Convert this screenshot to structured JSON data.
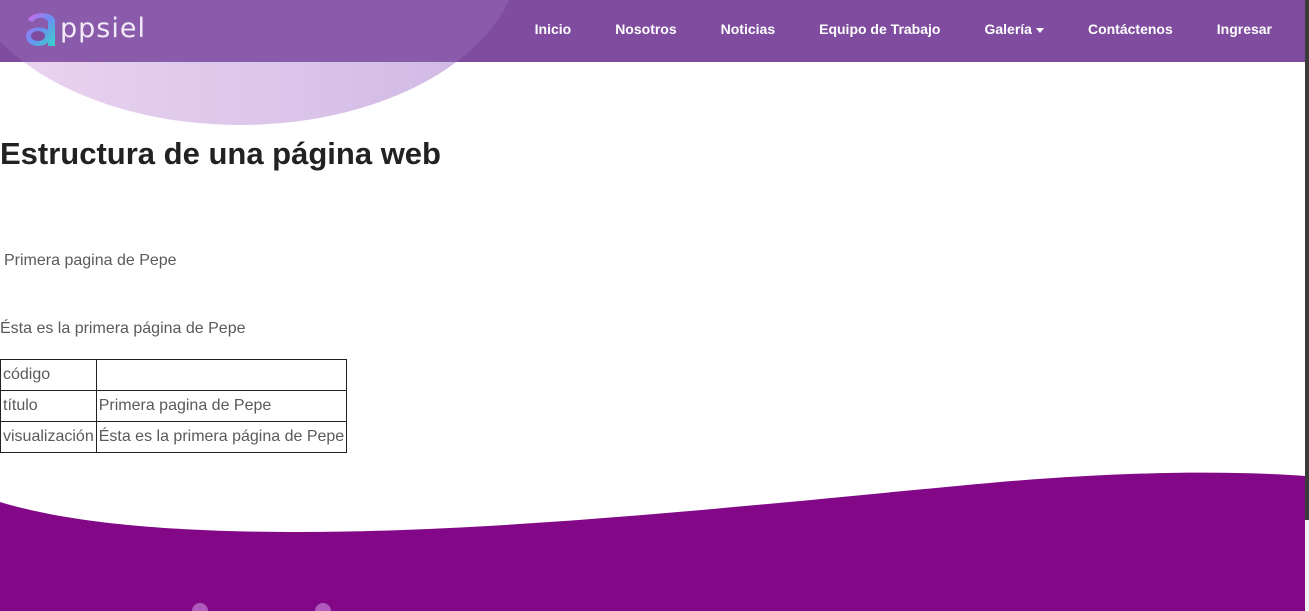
{
  "brand": {
    "logo_text": "ppsiel",
    "logo_letter": "a"
  },
  "nav": {
    "items": [
      "Inicio",
      "Nosotros",
      "Noticias",
      "Equipo de Trabajo",
      "Galería",
      "Contáctenos",
      "Ingresar"
    ]
  },
  "main": {
    "heading": "Estructura de una página web",
    "subtitle": "Primera pagina de Pepe",
    "paragraph": "Ésta es la primera página de Pepe",
    "table": [
      {
        "key": "código",
        "value": ""
      },
      {
        "key": "título",
        "value": "Primera pagina de Pepe"
      },
      {
        "key": "visualización",
        "value": "Ésta es la primera página de Pepe"
      }
    ]
  },
  "colors": {
    "navbar": "#7f4c9f",
    "footer": "#820887",
    "heading": "#222222",
    "text": "#5a5a5a"
  }
}
